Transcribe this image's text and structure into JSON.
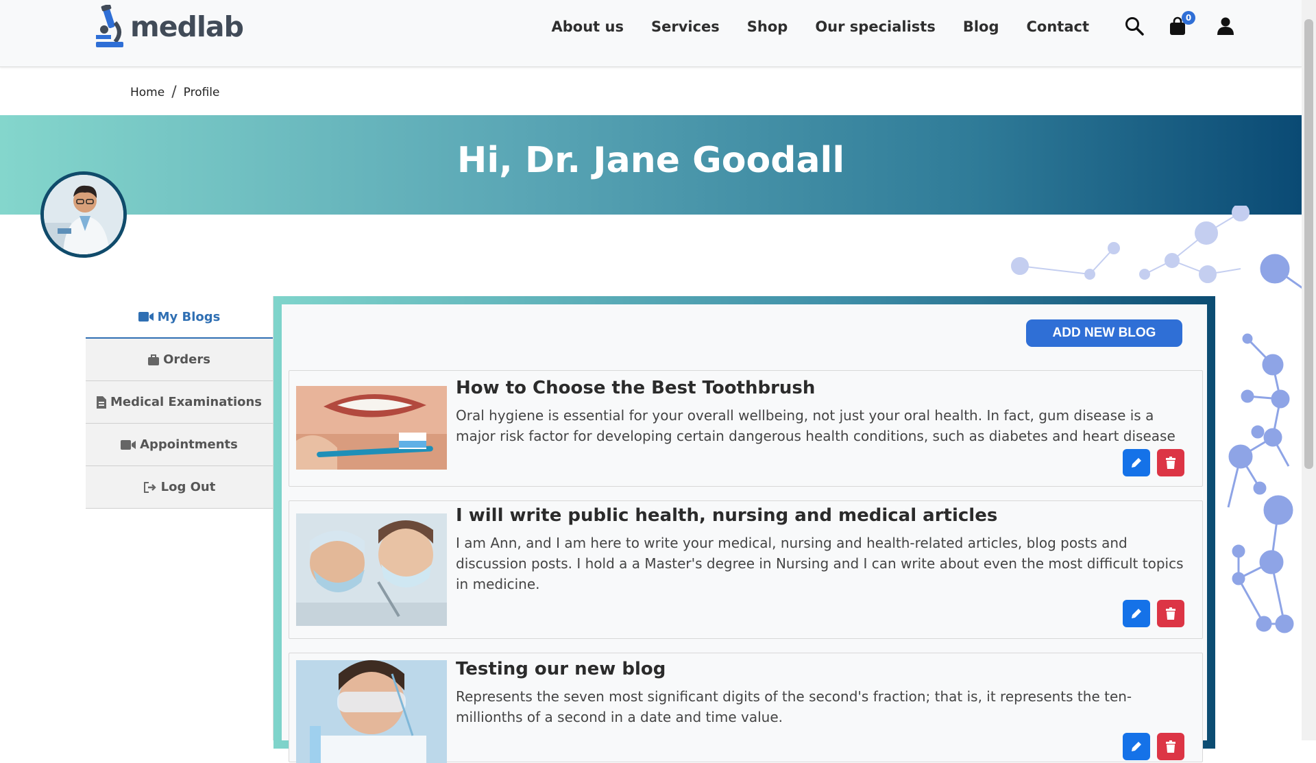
{
  "brand": {
    "name": "medlab"
  },
  "nav": {
    "items": [
      "About us",
      "Services",
      "Shop",
      "Our specialists",
      "Blog",
      "Contact"
    ],
    "cart_count": "0"
  },
  "breadcrumb": {
    "home": "Home",
    "separator": "/",
    "current": "Profile"
  },
  "banner": {
    "greeting": "Hi, Dr. Jane Goodall"
  },
  "sidebar": {
    "items": [
      {
        "label": "My Blogs",
        "icon": "video-camera-icon",
        "active": true
      },
      {
        "label": "Orders",
        "icon": "briefcase-icon",
        "active": false
      },
      {
        "label": "Medical Examinations",
        "icon": "file-icon",
        "active": false
      },
      {
        "label": "Appointments",
        "icon": "video-camera-icon",
        "active": false
      },
      {
        "label": "Log Out",
        "icon": "sign-out-icon",
        "active": false
      }
    ]
  },
  "main": {
    "add_button": "ADD NEW BLOG",
    "blogs": [
      {
        "title": "How to Choose the Best Toothbrush",
        "text": "Oral hygiene is essential for your overall wellbeing, not just your oral health. In fact, gum disease is a major risk factor for developing certain dangerous health conditions, such as diabetes and heart disease"
      },
      {
        "title": "I will write public health, nursing and medical articles",
        "text": "I am Ann, and I am here to write your medical, nursing and health-related articles, blog posts and discussion posts. I hold a a Master's degree in Nursing and I can write about even the most difficult topics in medicine."
      },
      {
        "title": "Testing our new blog",
        "text": "Represents the seven most significant digits of the second's fraction; that is, it represents the ten-millionths of a second in a date and time value."
      }
    ]
  },
  "colors": {
    "accent": "#2f6fd6",
    "edit": "#1572e8",
    "delete": "#dc3545",
    "banner_start": "#84d6cc",
    "banner_end": "#0a4a74"
  }
}
